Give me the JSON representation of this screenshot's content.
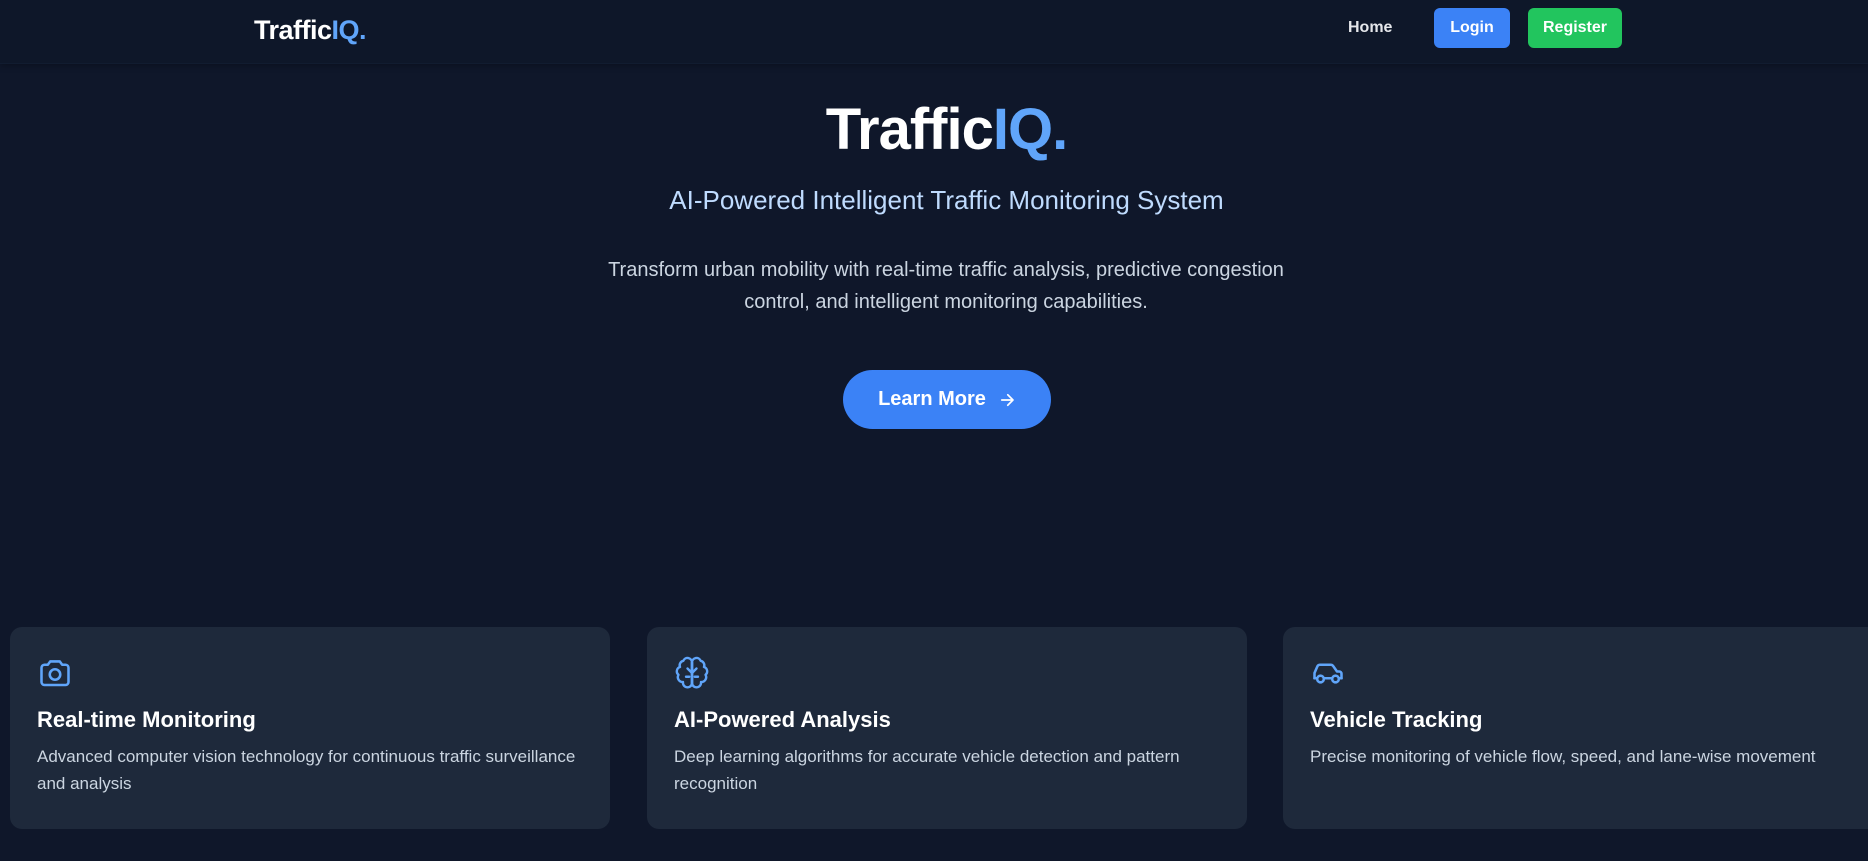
{
  "nav": {
    "logo_main": "Traffic",
    "logo_accent": "IQ.",
    "home_label": "Home",
    "login_label": "Login",
    "register_label": "Register"
  },
  "hero": {
    "title_main": "Traffic",
    "title_accent": "IQ.",
    "subtitle": "AI-Powered Intelligent Traffic Monitoring System",
    "description": "Transform urban mobility with real-time traffic analysis, predictive congestion control, and intelligent monitoring capabilities.",
    "cta_label": "Learn More",
    "cta_icon": "arrow-right-icon"
  },
  "features": [
    {
      "icon": "camera-icon",
      "title": "Real-time Monitoring",
      "description": "Advanced computer vision technology for continuous traffic surveillance and analysis"
    },
    {
      "icon": "brain-icon",
      "title": "AI-Powered Analysis",
      "description": "Deep learning algorithms for accurate vehicle detection and pattern recognition"
    },
    {
      "icon": "car-icon",
      "title": "Vehicle Tracking",
      "description": "Precise monitoring of vehicle flow, speed, and lane-wise movement"
    }
  ],
  "colors": {
    "background": "#0f172a",
    "card": "#1e293b",
    "accent": "#60a5fa",
    "login": "#3b82f6",
    "register": "#22c55e"
  }
}
